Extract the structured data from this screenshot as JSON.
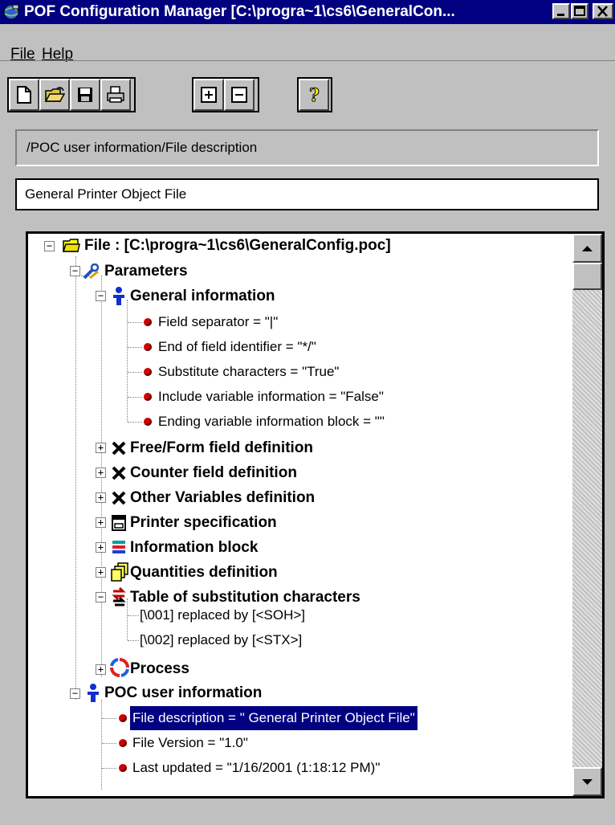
{
  "window": {
    "title": "POF Configuration Manager [C:\\progra~1\\cs6\\GeneralCon...",
    "icon": "app-globe-icon"
  },
  "menu": [
    {
      "label": "File",
      "hotkey": "F"
    },
    {
      "label": "Help",
      "hotkey": "H"
    }
  ],
  "toolbar": {
    "new": "new-file-icon",
    "open": "open-folder-icon",
    "save": "save-disk-icon",
    "print": "print-icon",
    "expand": "expand-plus-icon",
    "collapse": "collapse-minus-icon",
    "help": "help-question-icon"
  },
  "path": "/POC user information/File description",
  "description_value": "General Printer Object File",
  "tree": {
    "root": "File : [C:\\progra~1\\cs6\\GeneralConfig.poc]",
    "parameters": "Parameters",
    "general_information": "General information",
    "gi_items": [
      "Field separator = \"|\"",
      "End of field identifier = \"*/\"",
      "Substitute characters = \"True\"",
      "Include variable information = \"False\"",
      "Ending variable information block = \"\""
    ],
    "free_form": "Free/Form field definition",
    "counter": "Counter field definition",
    "other_vars": "Other Variables definition",
    "printer_spec": "Printer specification",
    "info_block": "Information block",
    "quantities": "Quantities definition",
    "substitution_table": "Table of substitution characters",
    "sub_items": [
      "[\\001] replaced by [<SOH>]",
      "[\\002] replaced by [<STX>]"
    ],
    "process": "Process",
    "poc_user_info": "POC user information",
    "poc_items": [
      "File description = \" General Printer Object File\"",
      "File Version = \"1.0\"",
      "Last updated = \"1/16/2001 (1:18:12 PM)\""
    ]
  },
  "colors": {
    "titlebar": "#000080",
    "selection": "#000080",
    "bullet": "#d00000",
    "face": "#c0c0c0"
  }
}
